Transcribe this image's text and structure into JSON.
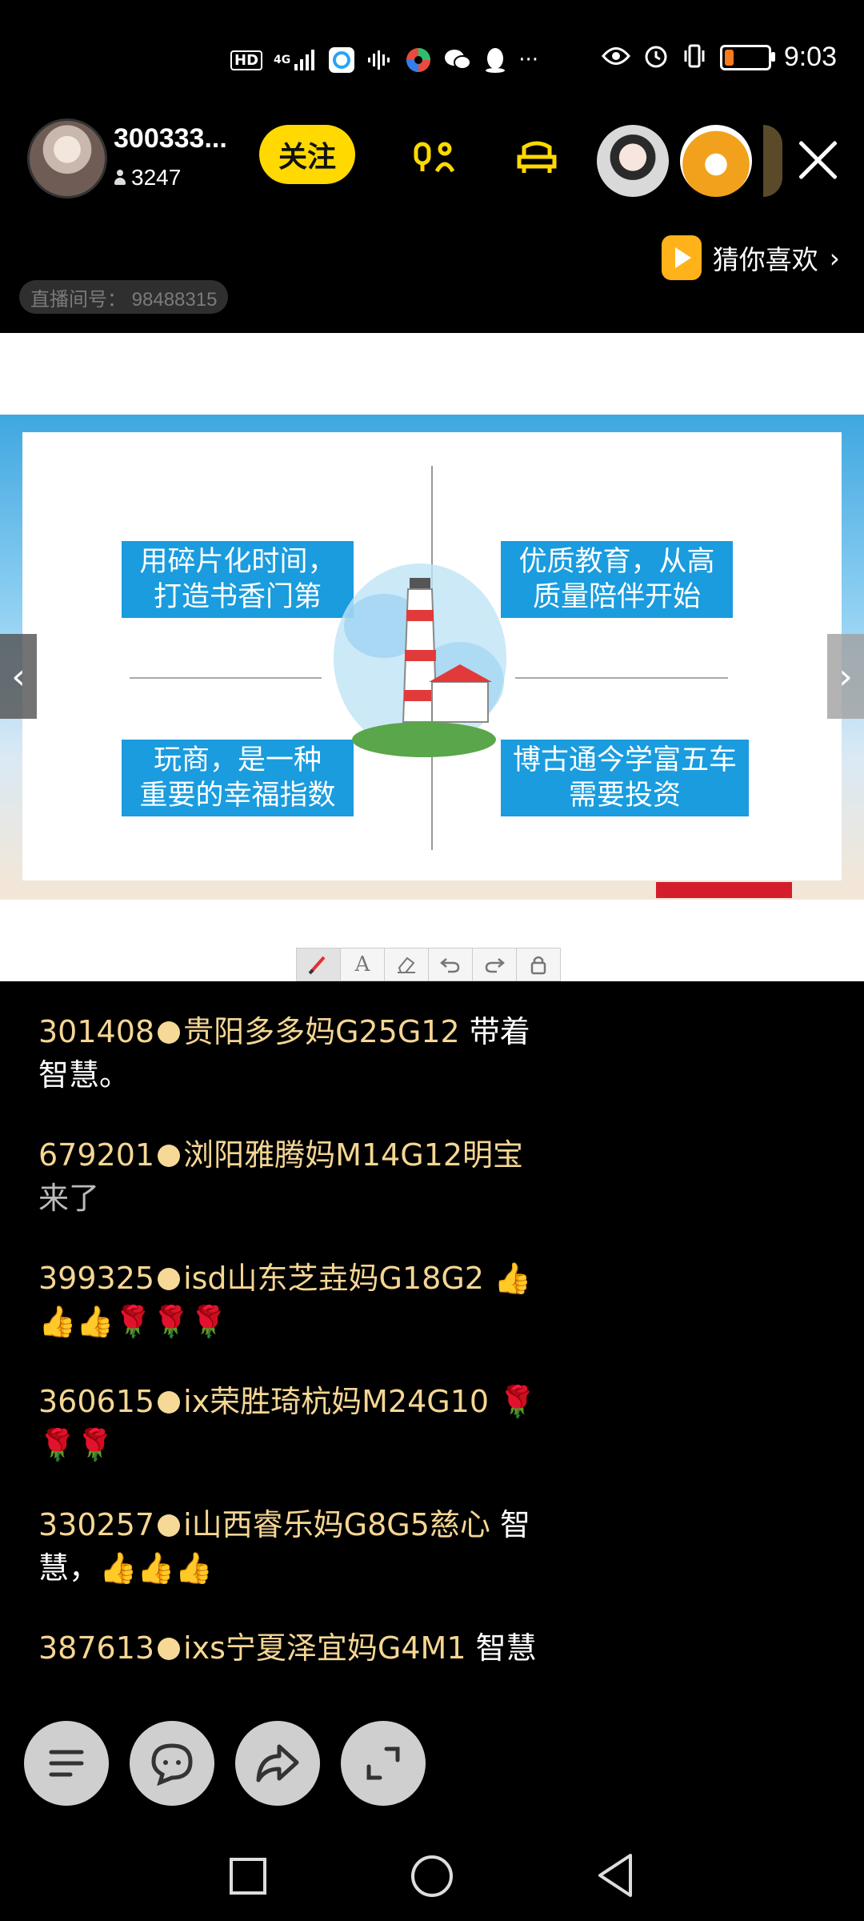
{
  "status_bar": {
    "left_icons": [
      "hd-icon",
      "signal-4g-icon",
      "app-icon-1",
      "audio-wave-icon",
      "app-icon-2",
      "wechat-icon",
      "qq-icon",
      "more-dots-icon"
    ],
    "hd_label": "HD",
    "network_label": "4G",
    "more_label": "···",
    "time": "9:03",
    "battery_level": 0.2,
    "battery_color": "#f47b20"
  },
  "header": {
    "host_name": "300333...",
    "host_followers": "3247",
    "follow_label": "关注",
    "accent_color": "#ffd900",
    "room_id_label": "直播间号：  98488315",
    "guess_like_label": "猜你喜欢",
    "chevron": "›"
  },
  "slide": {
    "quadrants": [
      "用碎片化时间，\n打造书香门第",
      "优质教育，从高\n质量陪伴开始",
      "玩商，是一种\n重要的幸福指数",
      "博古通今学富五车\n需要投资"
    ],
    "prev_label": "‹",
    "next_label": "›",
    "tool_text_label": "A"
  },
  "comments": [
    {
      "user": "301408",
      "name": "贵阳多多妈G25G12",
      "text": "带着\n智慧。",
      "grey": false
    },
    {
      "user": "679201",
      "name": "浏阳雅腾妈M14G12明宝",
      "text": "\n来了",
      "grey": true
    },
    {
      "user": "399325",
      "name": "isd山东芝垚妈G18G2",
      "text": "👍\n👍👍🌹🌹🌹",
      "grey": false
    },
    {
      "user": "360615",
      "name": "ix荣胜琦杭妈M24G10",
      "text": "🌹\n🌹🌹",
      "grey": false
    },
    {
      "user": "330257",
      "name": "i山西睿乐妈G8G5慈心",
      "text": "智\n慧，👍👍👍",
      "grey": false
    },
    {
      "user": "387613",
      "name": "ixs宁夏泽宜妈G4M1",
      "text": "智慧",
      "grey": false
    }
  ]
}
